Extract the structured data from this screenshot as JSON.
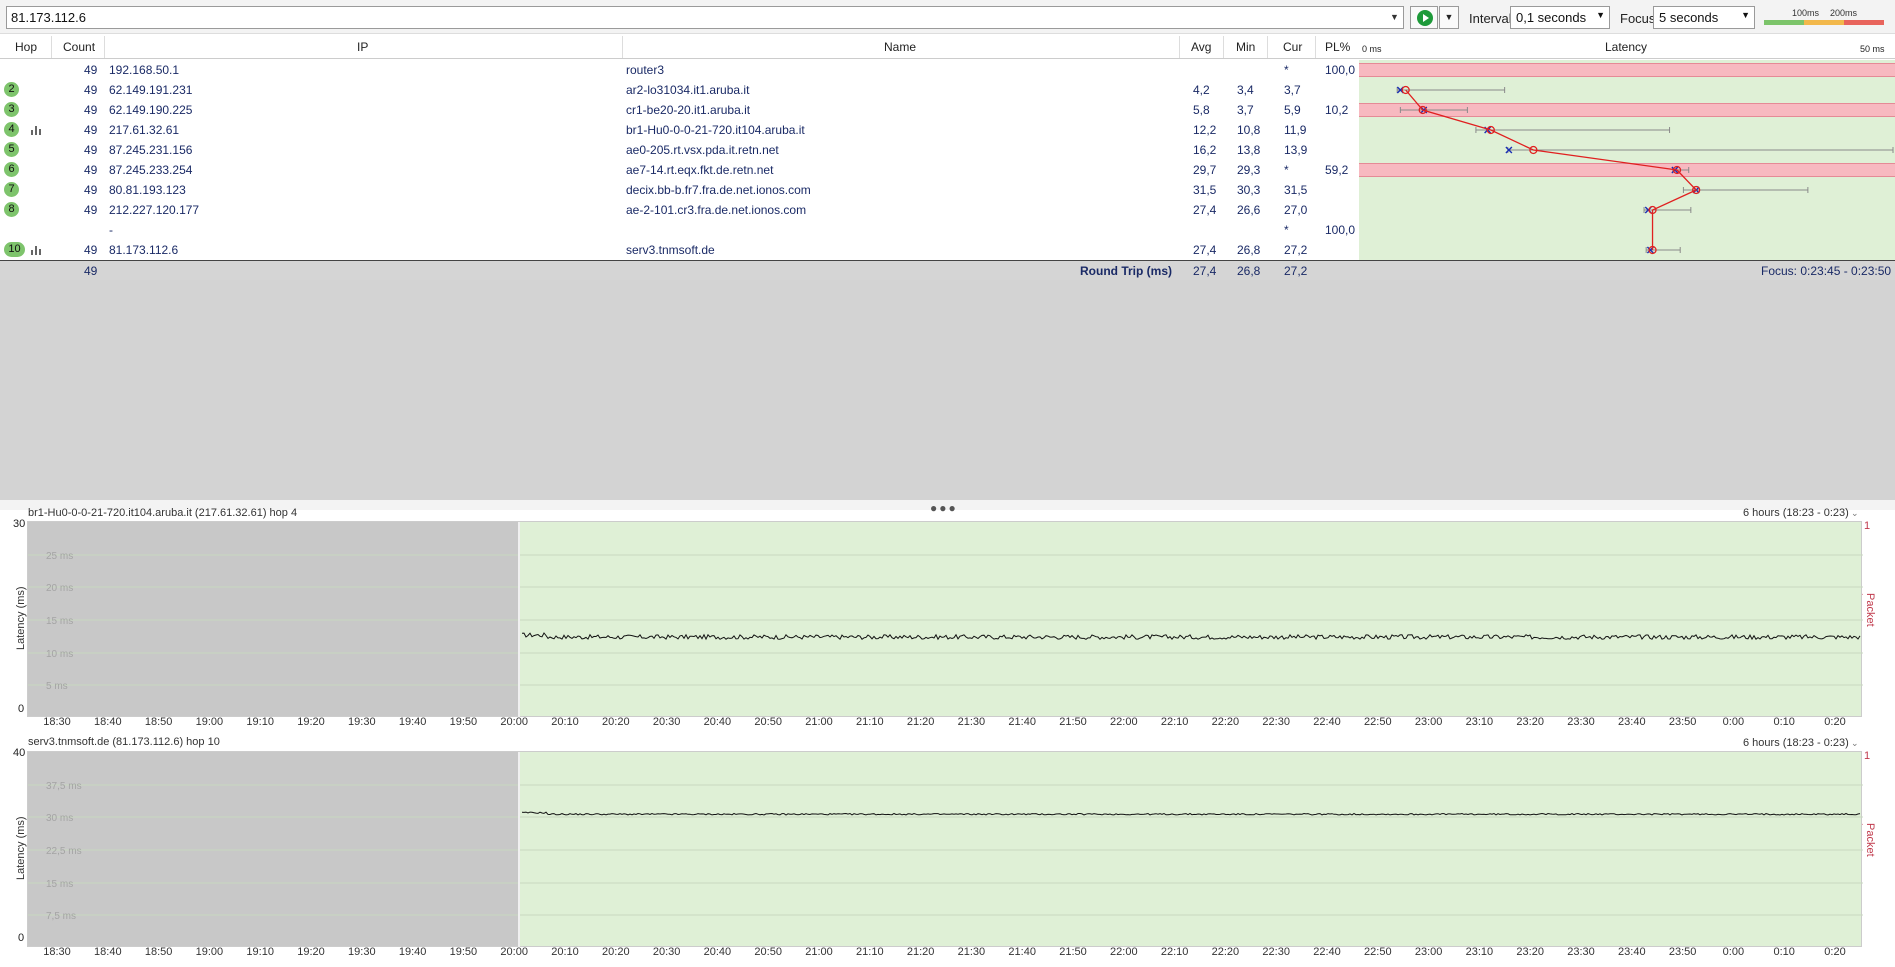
{
  "toolbar": {
    "target_value": "81.173.112.6",
    "interval_label": "Interval",
    "interval_value": "0,1 seconds",
    "focus_label": "Focus",
    "focus_value": "5 seconds",
    "legend": {
      "t1": "100ms",
      "t2": "200ms",
      "colors": [
        "#7cc46a",
        "#f2b84b",
        "#e8645c"
      ]
    }
  },
  "table": {
    "headers": {
      "hop": "Hop",
      "count": "Count",
      "ip": "IP",
      "name": "Name",
      "avg": "Avg",
      "min": "Min",
      "cur": "Cur",
      "pl": "PL%",
      "latency": "Latency",
      "lat_min": "0 ms",
      "lat_max": "50 ms"
    },
    "rows": [
      {
        "hop": "",
        "count": "49",
        "ip": "192.168.50.1",
        "name": "router3",
        "avg": "",
        "min": "",
        "cur": "*",
        "pl": "100,0",
        "loss": true
      },
      {
        "hop": "2",
        "count": "49",
        "ip": "62.149.191.231",
        "name": "ar2-lo31034.it1.aruba.it",
        "avg": "4,2",
        "min": "3,4",
        "cur": "3,7",
        "pl": "",
        "loss": false
      },
      {
        "hop": "3",
        "count": "49",
        "ip": "62.149.190.225",
        "name": "cr1-be20-20.it1.aruba.it",
        "avg": "5,8",
        "min": "3,7",
        "cur": "5,9",
        "pl": "10,2",
        "loss": true
      },
      {
        "hop": "4",
        "count": "49",
        "ip": "217.61.32.61",
        "name": "br1-Hu0-0-0-21-720.it104.aruba.it",
        "avg": "12,2",
        "min": "10,8",
        "cur": "11,9",
        "pl": "",
        "loss": false,
        "graph": true
      },
      {
        "hop": "5",
        "count": "49",
        "ip": "87.245.231.156",
        "name": "ae0-205.rt.vsx.pda.it.retn.net",
        "avg": "16,2",
        "min": "13,8",
        "cur": "13,9",
        "pl": "",
        "loss": false
      },
      {
        "hop": "6",
        "count": "49",
        "ip": "87.245.233.254",
        "name": "ae7-14.rt.eqx.fkt.de.retn.net",
        "avg": "29,7",
        "min": "29,3",
        "cur": "*",
        "pl": "59,2",
        "loss": true
      },
      {
        "hop": "7",
        "count": "49",
        "ip": "80.81.193.123",
        "name": "decix.bb-b.fr7.fra.de.net.ionos.com",
        "avg": "31,5",
        "min": "30,3",
        "cur": "31,5",
        "pl": "",
        "loss": false
      },
      {
        "hop": "8",
        "count": "49",
        "ip": "212.227.120.177",
        "name": "ae-2-101.cr3.fra.de.net.ionos.com",
        "avg": "27,4",
        "min": "26,6",
        "cur": "27,0",
        "pl": "",
        "loss": false
      },
      {
        "hop": "",
        "count": "",
        "ip": "-",
        "name": "",
        "avg": "",
        "min": "",
        "cur": "*",
        "pl": "100,0",
        "loss": false
      },
      {
        "hop": "10",
        "count": "49",
        "ip": "81.173.112.6",
        "name": "serv3.tnmsoft.de",
        "avg": "27,4",
        "min": "26,8",
        "cur": "27,2",
        "pl": "",
        "loss": false,
        "graph": true
      }
    ],
    "roundtrip": {
      "count": "49",
      "label": "Round Trip (ms)",
      "avg": "27,4",
      "min": "26,8",
      "cur": "27,2",
      "focus": "Focus: 0:23:45 - 0:23:50"
    }
  },
  "latency_chart": {
    "scale_max_ms": 50,
    "hops": [
      {
        "row": 1,
        "avg": 4.2,
        "min": 3.4,
        "cur": 3.7,
        "max": 13.5
      },
      {
        "row": 2,
        "avg": 5.8,
        "min": 3.7,
        "cur": 5.9,
        "max": 10.0
      },
      {
        "row": 3,
        "avg": 12.2,
        "min": 10.8,
        "cur": 11.9,
        "max": 29.0
      },
      {
        "row": 4,
        "avg": 16.2,
        "min": 13.8,
        "cur": 13.9,
        "max": 50.0
      },
      {
        "row": 5,
        "avg": 29.7,
        "min": 29.3,
        "cur": 29.5,
        "max": 30.8
      },
      {
        "row": 6,
        "avg": 31.5,
        "min": 30.3,
        "cur": 31.5,
        "max": 42.0
      },
      {
        "row": 7,
        "avg": 27.4,
        "min": 26.6,
        "cur": 27.0,
        "max": 31.0
      },
      {
        "row": 9,
        "avg": 27.4,
        "min": 26.8,
        "cur": 27.2,
        "max": 30.0
      }
    ]
  },
  "graphs": [
    {
      "title": "br1-Hu0-0-0-21-720.it104.aruba.it (217.61.32.61) hop 4",
      "range": "6 hours (18:23 - 0:23)",
      "ylabel": "Latency (ms)",
      "ylabel_right": "Packet Loss %",
      "ymax_label": "30",
      "ymin_label": "0",
      "right_top": "1",
      "grid_labels": [
        "25 ms",
        "20 ms",
        "15 ms",
        "10 ms",
        "5 ms"
      ],
      "ymax": 30,
      "series_level": 12.4,
      "series_noise": 0.35
    },
    {
      "title": "serv3.tnmsoft.de (81.173.112.6) hop 10",
      "range": "6 hours (18:23 - 0:23)",
      "ylabel": "Latency (ms)",
      "ylabel_right": "Packet Loss %",
      "ymax_label": "40",
      "ymin_label": "0",
      "right_top": "1",
      "grid_labels": [
        "37,5 ms",
        "30 ms",
        "22,5 ms",
        "15 ms",
        "7,5 ms"
      ],
      "ymax": 40,
      "series_level": 27.3,
      "series_noise": 0.15
    }
  ],
  "xaxis": [
    "18:30",
    "18:40",
    "18:50",
    "19:00",
    "19:10",
    "19:20",
    "19:30",
    "19:40",
    "19:50",
    "20:00",
    "20:10",
    "20:20",
    "20:30",
    "20:40",
    "20:50",
    "21:00",
    "21:10",
    "21:20",
    "21:30",
    "21:40",
    "21:50",
    "22:00",
    "22:10",
    "22:20",
    "22:30",
    "22:40",
    "22:50",
    "23:00",
    "23:10",
    "23:20",
    "23:30",
    "23:40",
    "23:50",
    "0:00",
    "0:10",
    "0:20"
  ]
}
